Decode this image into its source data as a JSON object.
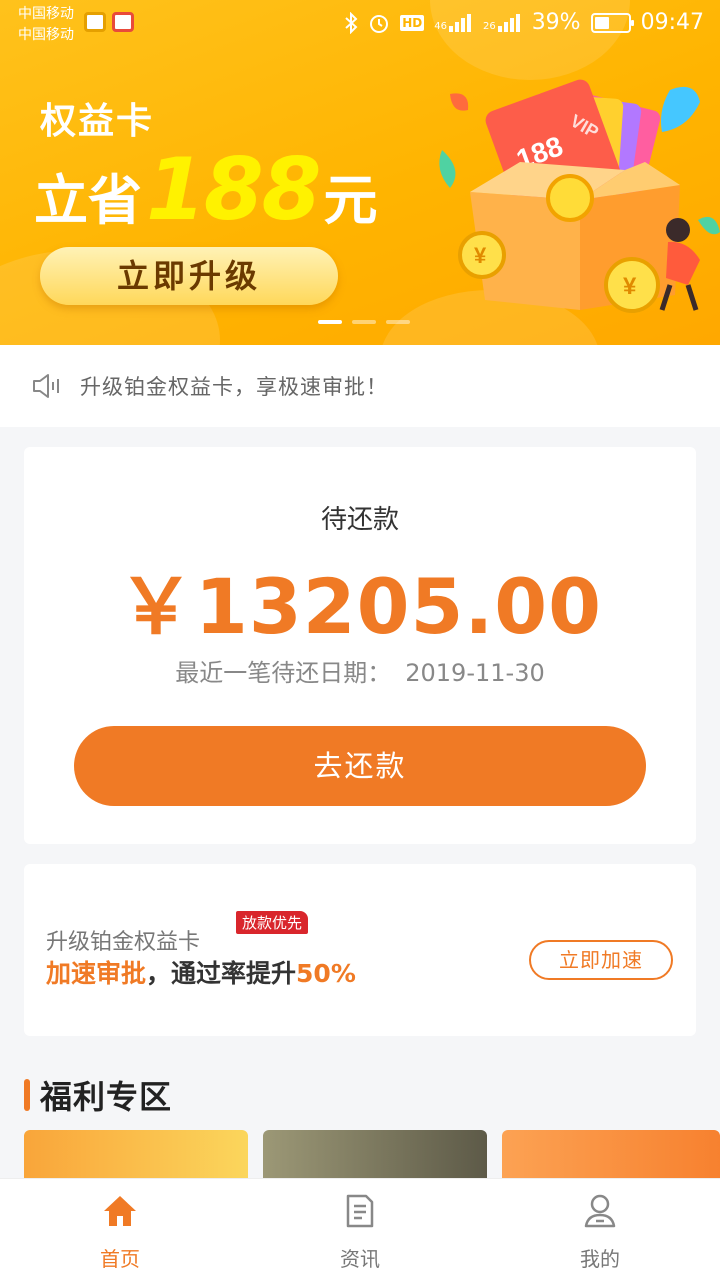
{
  "status_bar": {
    "carrier_1": "中国移动",
    "carrier_2": "中国移动",
    "hd": "HD",
    "net1": "46",
    "net2": "26",
    "battery": "39%",
    "time": "09:47"
  },
  "banner": {
    "line1": "权益卡",
    "line2_prefix": "立省",
    "line2_amount": "188",
    "line2_suffix": "元",
    "upgrade_button": "立即升级",
    "card_text": "188",
    "vip_text": "VIP",
    "coin_symbol": "¥",
    "slide_count": 3,
    "active_slide": 1
  },
  "notice": {
    "icon": "speaker-icon",
    "text": "升级铂金权益卡，享极速审批！"
  },
  "repayment": {
    "label": "待还款",
    "amount": "￥13205.00",
    "date_label": "最近一笔待还日期：",
    "date_value": "2019-11-30",
    "button": "去还款"
  },
  "promo": {
    "title": "升级铂金权益卡",
    "badge": "放款优先",
    "line_highlight": "加速审批",
    "line_middle": "，通过率提升",
    "line_percent": "50%",
    "button": "立即加速"
  },
  "welfare": {
    "title": "福利专区"
  },
  "tabbar": {
    "tabs": [
      {
        "label": "首页",
        "icon": "home-icon",
        "active": true
      },
      {
        "label": "资讯",
        "icon": "news-icon",
        "active": false
      },
      {
        "label": "我的",
        "icon": "user-icon",
        "active": false
      }
    ]
  },
  "colors": {
    "accent": "#f07a25",
    "banner": "#ffb400",
    "badge": "#d9262c"
  }
}
